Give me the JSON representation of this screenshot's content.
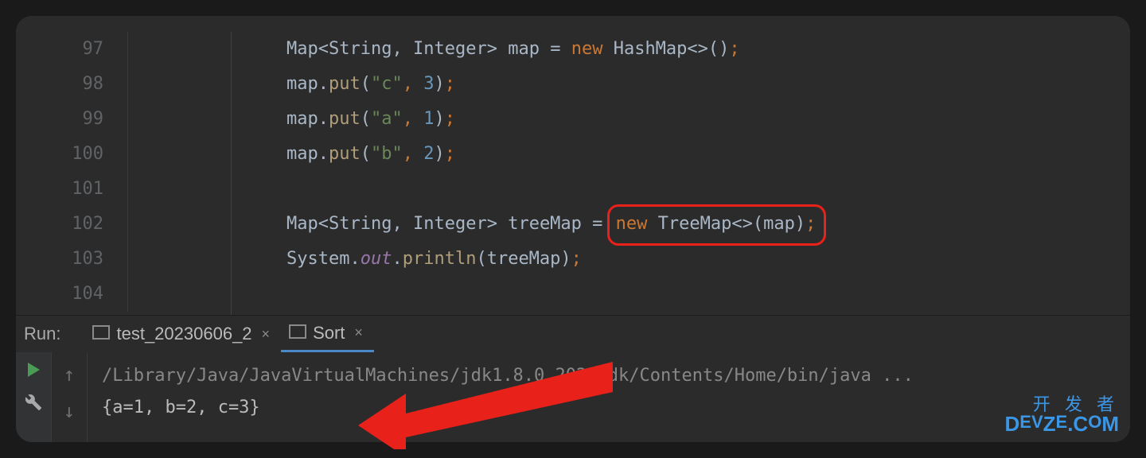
{
  "gutter": {
    "l97": "97",
    "l98": "98",
    "l99": "99",
    "l100": "100",
    "l101": "101",
    "l102": "102",
    "l103": "103",
    "l104": "104"
  },
  "code": {
    "Map": "Map",
    "lt": "<",
    "gt": ">",
    "String": "String",
    "comma": ",",
    "space": " ",
    "Integer": "Integer",
    "mapVar": "map",
    "eq": "=",
    "new": "new",
    "HashMap": "HashMap",
    "diamond": "<>",
    "lpar": "(",
    "rpar": ")",
    "semi": ";",
    "put": "put",
    "dot": ".",
    "qc": "\"c\"",
    "qa": "\"a\"",
    "qb": "\"b\"",
    "n3": "3",
    "n1": "1",
    "n2": "2",
    "treeMapVar": "treeMap",
    "TreeMap": "TreeMap",
    "System": "System",
    "out": "out",
    "println": "println"
  },
  "run": {
    "label": "Run:",
    "tab1": "test_20230606_2",
    "tab2": "Sort",
    "close": "×",
    "cmdline": "/Library/Java/JavaVirtualMachines/jdk1.8.0_202.jdk/Contents/Home/bin/java ...",
    "output": "{a=1, b=2, c=3}"
  },
  "watermark": {
    "l1": "开 发 者",
    "l2a": "D",
    "l2b": "EV",
    "l2c": "Z",
    "l2d": "E",
    "l2e": ".C",
    "l2f": "O",
    "l2g": "M"
  }
}
